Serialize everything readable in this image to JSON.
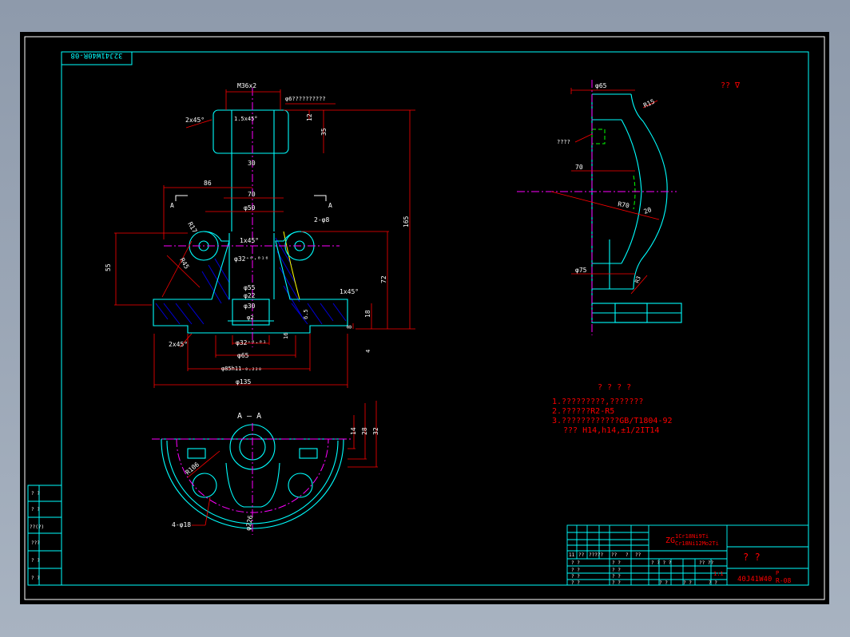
{
  "colors": {
    "background": "#000000",
    "frame": "#00ffff",
    "dimension": "#ff0000",
    "geometry": "#00ffff",
    "hatch": "#0000ff",
    "centerline": "#ff00ff",
    "hidden": "#00ff00",
    "yellow": "#ffff00",
    "white": "#ffffff"
  },
  "title_strip_text": "32J41W40R-08",
  "top_right_symbol": "?? ∇",
  "front_view": {
    "dims": {
      "thread": "M36x2",
      "ref_a": "A",
      "note_top": "φ6??????????",
      "chamfer_top": "2x45°",
      "chamfer_inner": "1.5x45°",
      "h35": "35",
      "h12": "12",
      "w30": "30",
      "w86": "86",
      "w70": "70",
      "d50": "φ50",
      "holes": "2-φ8",
      "r17": "R17",
      "r45": "R45",
      "chamfer_bore": "1x45°",
      "d32": "φ32⁺⁰·⁰¹⁶",
      "d55": "φ55",
      "d22": "φ22",
      "d30": "φ30",
      "d2": "φ2",
      "h55": "55",
      "h72": "72",
      "h165": "165",
      "h18": "18",
      "h8": "8",
      "h6_5": "6.5",
      "h16": "16",
      "h4": "4",
      "chamfer_left": "2x45°",
      "chamfer_right": "1x45°",
      "bottom_d32": "φ32⁺⁰·⁰¹",
      "d65": "φ65",
      "d85": "φ85h11₋₀.₂₂₀",
      "d135": "φ135"
    }
  },
  "section_view": {
    "title": "A — A",
    "h14": "14",
    "h28": "28",
    "h32": "32",
    "r106": "R106",
    "holes": "4-φ18",
    "d226": "φ226"
  },
  "side_view": {
    "d65": "φ65",
    "r15": "R15",
    "label": "????",
    "h70": "70",
    "r70": "R70",
    "w20": "20",
    "d75": "φ75",
    "r3": "R3"
  },
  "notes": {
    "heading": "? ? ? ?",
    "line1": "1.?????????,???????",
    "line2": "2.??????R2-R5",
    "line3": "3.????????????GB/T1804-92",
    "line4": "???  H14,h14,±1/2IT14"
  },
  "title_block": {
    "material_line1": "ZG",
    "material_sub1": "1Cr18Ni9Ti",
    "material_sub2": "Cr18Ni12Mo2Ti",
    "name": "?   ?",
    "scale": "1:1",
    "drawing_no": "40J41W40",
    "drawing_no_suffix_top": "P",
    "drawing_no_suffix_bottom": "R-08",
    "header_cells": [
      "11",
      "??",
      "?????",
      "??",
      "?",
      "??"
    ],
    "left_cells": [
      "? ?",
      "? ?",
      "? ?",
      "? ?"
    ],
    "mid_cells": [
      "? ?",
      "? ?",
      "? ?",
      "? ?"
    ],
    "right_cells": [
      "? ? ? ?",
      "?? ??",
      "? ?",
      "? ?",
      "? ?"
    ]
  },
  "left_strip": [
    "? ?",
    "? ?",
    "??(?)",
    "???",
    "? ?",
    "? ?"
  ]
}
